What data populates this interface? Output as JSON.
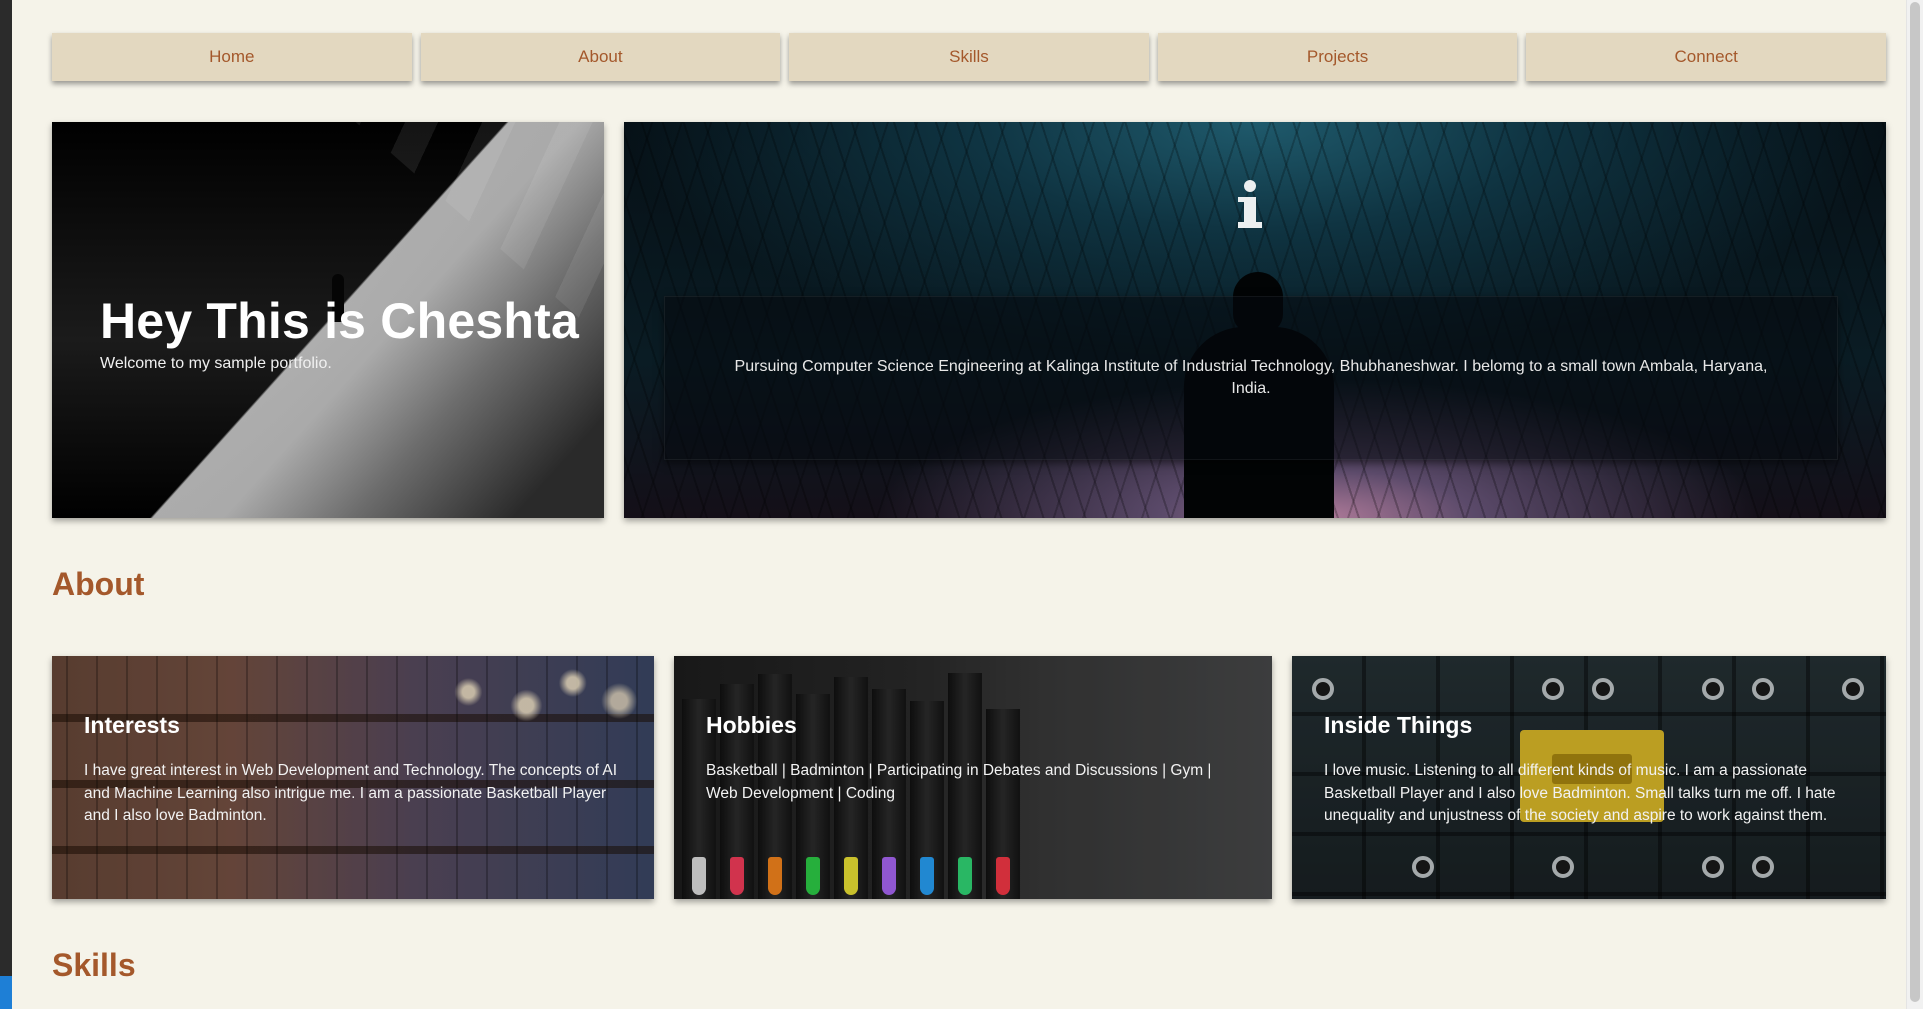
{
  "colors": {
    "background": "#f5f3e9",
    "nav_bg": "#e3d8c0",
    "accent": "#a4582b"
  },
  "nav": {
    "items": [
      {
        "label": "Home"
      },
      {
        "label": "About"
      },
      {
        "label": "Skills"
      },
      {
        "label": "Projects"
      },
      {
        "label": "Connect"
      }
    ]
  },
  "hero": {
    "title": "Hey This is Cheshta",
    "subtitle": "Welcome to my sample portfolio.",
    "info_icon": "info-icon",
    "info_text": "Pursuing Computer Science Engineering at Kalinga Institute of Industrial Technology, Bhubhaneshwar. I belomg to a small town Ambala, Haryana, India."
  },
  "about": {
    "heading": "About",
    "cards": [
      {
        "title": "Interests",
        "text": "I have great interest in Web Development and Technology. The concepts of AI and Machine Learning also intrigue me. I am a passionate Basketball Player and I also love Badminton."
      },
      {
        "title": "Hobbies",
        "text": "Basketball | Badminton | Participating in Debates and Discussions | Gym | Web Development | Coding"
      },
      {
        "title": "Inside Things",
        "text": "I love music. Listening to all different kinds of music. I am a passionate Basketball Player and I also love Badminton. Small talks turn me off. I hate unequality and unjustness of the society and aspire to work against them."
      }
    ]
  },
  "skills": {
    "heading": "Skills"
  }
}
